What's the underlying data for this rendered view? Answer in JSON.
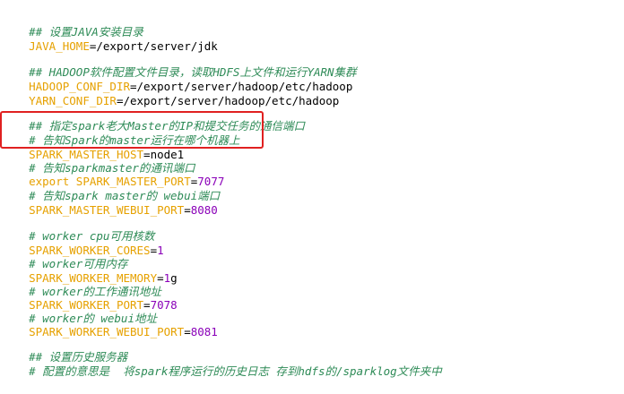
{
  "lines": [
    {
      "kind": "comment",
      "text": "## 设置JAVA安装目录"
    },
    {
      "kind": "assign",
      "key": "JAVA_HOME",
      "eq": "=",
      "value": "/export/server/jdk"
    },
    {
      "kind": "comment",
      "text": "## HADOOP软件配置文件目录，读取HDFS上文件和运行YARN集群"
    },
    {
      "kind": "assign",
      "key": "HADOOP_CONF_DIR",
      "eq": "=",
      "value": "/export/server/hadoop/etc/hadoop"
    },
    {
      "kind": "assign",
      "key": "YARN_CONF_DIR",
      "eq": "=",
      "value": "/export/server/hadoop/etc/hadoop"
    },
    {
      "kind": "comment",
      "text": "## 指定spark老大Master的IP和提交任务的通信端口"
    },
    {
      "kind": "comment",
      "text": "# 告知Spark的master运行在哪个机器上"
    },
    {
      "kind": "assign",
      "key": "SPARK_MASTER_HOST",
      "eq": "=",
      "value": "node1"
    },
    {
      "kind": "comment",
      "text": "# 告知sparkmaster的通讯端口"
    },
    {
      "kind": "export",
      "export_kw": "export ",
      "key": "SPARK_MASTER_PORT",
      "eq": "=",
      "value": "7077"
    },
    {
      "kind": "comment",
      "text": "# 告知spark master的 webui端口"
    },
    {
      "kind": "assign-num",
      "key": "SPARK_MASTER_WEBUI_PORT",
      "eq": "=",
      "value": "8080"
    },
    {
      "kind": "comment",
      "text": "# worker cpu可用核数"
    },
    {
      "kind": "assign-num",
      "key": "SPARK_WORKER_CORES",
      "eq": "=",
      "value": "1"
    },
    {
      "kind": "comment",
      "text": "# worker可用内存"
    },
    {
      "kind": "assign-mem",
      "key": "SPARK_WORKER_MEMORY",
      "eq": "=",
      "value": "1",
      "unit": "g"
    },
    {
      "kind": "comment",
      "text": "# worker的工作通讯地址"
    },
    {
      "kind": "assign-num",
      "key": "SPARK_WORKER_PORT",
      "eq": "=",
      "value": "7078"
    },
    {
      "kind": "comment",
      "text": "# worker的 webui地址"
    },
    {
      "kind": "assign-num",
      "key": "SPARK_WORKER_WEBUI_PORT",
      "eq": "=",
      "value": "8081"
    },
    {
      "kind": "comment",
      "text": "## 设置历史服务器"
    },
    {
      "kind": "comment",
      "text": "# 配置的意思是  将spark程序运行的历史日志 存到hdfs的/sparklog文件夹中"
    }
  ],
  "colors": {
    "comment": "#2e8b57",
    "variable": "#e6a100",
    "number": "#8a00b8",
    "highlight_border": "#e02020"
  }
}
